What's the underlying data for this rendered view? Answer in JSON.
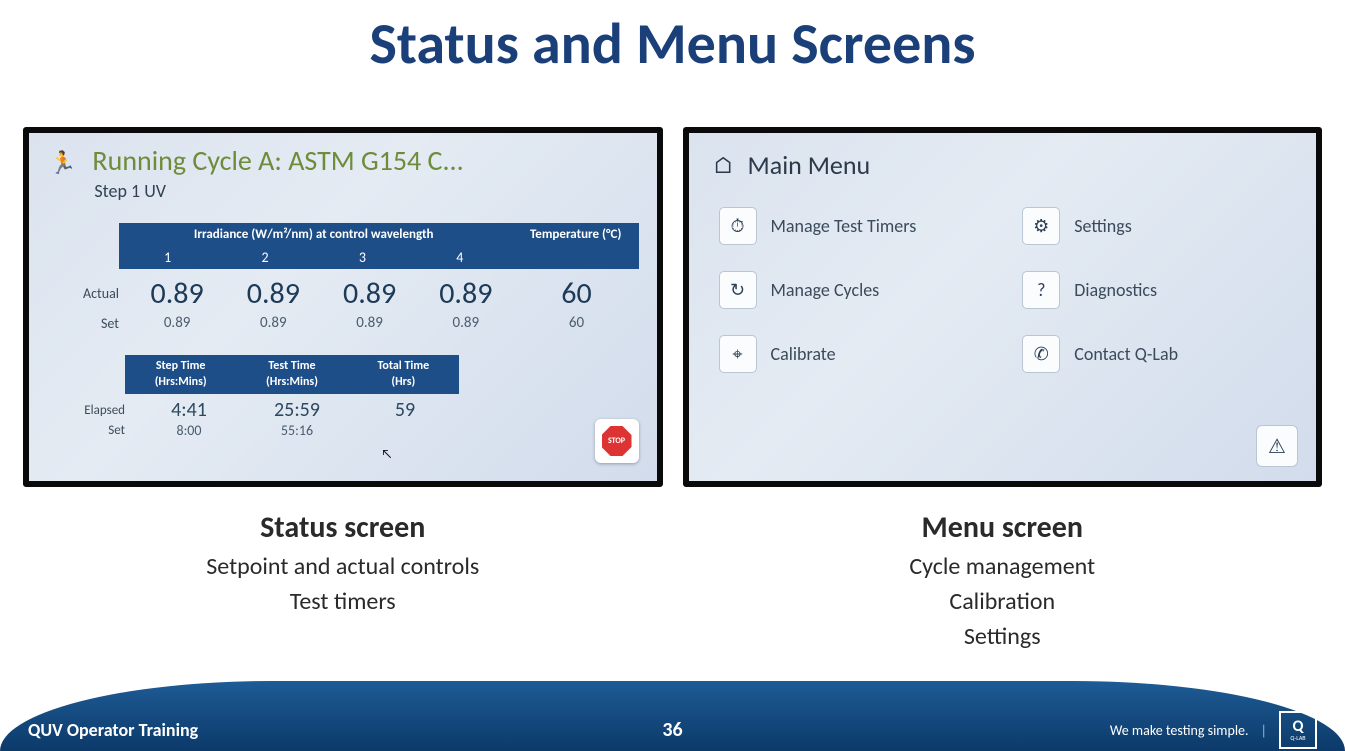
{
  "slide": {
    "title": "Status and Menu Screens",
    "pageNumber": "36",
    "footerLeft": "QUV Operator Training",
    "footerTag": "We make testing simple.",
    "logoText": "Q",
    "logoSub": "Q-LAB"
  },
  "status": {
    "runningTitle": "Running Cycle A: ASTM G154 C...",
    "runningStep": "Step 1 UV",
    "irrHeader": "Irradiance (W/m²/nm) at control wavelength",
    "tempHeader": "Temperature (°C)",
    "cols": [
      "1",
      "2",
      "3",
      "4"
    ],
    "rowLabelActual": "Actual",
    "rowLabelSet": "Set",
    "actualVals": [
      "0.89",
      "0.89",
      "0.89",
      "0.89"
    ],
    "actualTemp": "60",
    "setVals": [
      "0.89",
      "0.89",
      "0.89",
      "0.89"
    ],
    "setTemp": "60",
    "timeHeaders": [
      {
        "t1": "Step Time",
        "t2": "(Hrs:Mins)"
      },
      {
        "t1": "Test Time",
        "t2": "(Hrs:Mins)"
      },
      {
        "t1": "Total Time",
        "t2": "(Hrs)"
      }
    ],
    "elapsedLabel": "Elapsed",
    "elapsedVals": [
      "4:41",
      "25:59",
      "59"
    ],
    "setLabel2": "Set",
    "setVals2": [
      "8:00",
      "55:16",
      ""
    ],
    "stopLabel": "STOP"
  },
  "menu": {
    "title": "Main Menu",
    "items": [
      {
        "label": "Manage Test Timers"
      },
      {
        "label": "Settings"
      },
      {
        "label": "Manage Cycles"
      },
      {
        "label": "Diagnostics"
      },
      {
        "label": "Calibrate"
      },
      {
        "label": "Contact Q-Lab"
      }
    ]
  },
  "captions": {
    "left": {
      "title": "Status screen",
      "lines": [
        "Setpoint and actual controls",
        "Test timers"
      ]
    },
    "right": {
      "title": "Menu screen",
      "lines": [
        "Cycle management",
        "Calibration",
        "Settings"
      ]
    }
  }
}
